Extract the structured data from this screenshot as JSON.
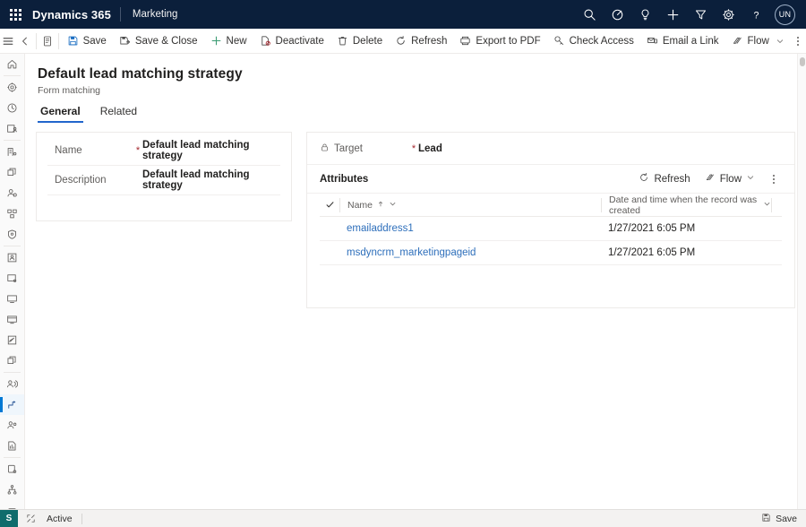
{
  "suitebar": {
    "waffle": "app-launcher",
    "brand": "Dynamics 365",
    "app_name": "Marketing",
    "avatar_initials": "UN",
    "icons": [
      {
        "name": "search-icon",
        "label": "Search"
      },
      {
        "name": "focus-target-icon",
        "label": "Focused view"
      },
      {
        "name": "lightbulb-icon",
        "label": "Insights"
      },
      {
        "name": "plus-icon",
        "label": "Quick create"
      },
      {
        "name": "filter-icon",
        "label": "Filter"
      },
      {
        "name": "gear-icon",
        "label": "Settings"
      },
      {
        "name": "help-icon",
        "label": "Help"
      }
    ],
    "colors": {
      "background": "#0b1f3b",
      "foreground": "#ffffff"
    }
  },
  "commandbar": {
    "hamburger": "site-map-toggle",
    "back": "back-arrow",
    "form_selector": "form-icon",
    "items": [
      {
        "name": "save-button",
        "label": "Save",
        "icon": "save-icon"
      },
      {
        "name": "save-and-close-button",
        "label": "Save & Close",
        "icon": "save-close-icon"
      },
      {
        "name": "new-button",
        "label": "New",
        "icon": "plus-icon"
      },
      {
        "name": "deactivate-button",
        "label": "Deactivate",
        "icon": "deactivate-icon"
      },
      {
        "name": "delete-button",
        "label": "Delete",
        "icon": "trash-icon"
      },
      {
        "name": "refresh-button",
        "label": "Refresh",
        "icon": "refresh-icon"
      },
      {
        "name": "export-to-pdf-button",
        "label": "Export to PDF",
        "icon": "pdf-icon"
      },
      {
        "name": "check-access-button",
        "label": "Check Access",
        "icon": "key-icon"
      },
      {
        "name": "email-a-link-button",
        "label": "Email a Link",
        "icon": "email-link-icon"
      },
      {
        "name": "flow-button",
        "label": "Flow",
        "icon": "flow-icon",
        "has_chevron": true
      }
    ],
    "overflow": "more-commands"
  },
  "sidebar": {
    "selected_index": 16,
    "items": [
      {
        "name": "sidebar-item-home",
        "icon": "home-icon"
      },
      {
        "name": "sidebar-item-settings",
        "icon": "gear-icon"
      },
      {
        "name": "sidebar-item-recent",
        "icon": "clock-icon"
      },
      {
        "name": "sidebar-item-contacts",
        "icon": "contact-card-icon"
      },
      {
        "name": "sidebar-item-accounts",
        "icon": "building-icon"
      },
      {
        "name": "sidebar-item-segments",
        "icon": "layers-icon"
      },
      {
        "name": "sidebar-item-leads",
        "icon": "person-search-icon"
      },
      {
        "name": "sidebar-item-journeys",
        "icon": "grid-nodes-icon"
      },
      {
        "name": "sidebar-item-security",
        "icon": "shield-icon"
      },
      {
        "name": "sidebar-item-forms",
        "icon": "form-card-icon"
      },
      {
        "name": "sidebar-item-pages",
        "icon": "page-icon"
      },
      {
        "name": "sidebar-item-templates",
        "icon": "monitor-icon"
      },
      {
        "name": "sidebar-item-websites",
        "icon": "browser-icon"
      },
      {
        "name": "sidebar-item-surveys",
        "icon": "edit-page-icon"
      },
      {
        "name": "sidebar-item-stacks",
        "icon": "copy-icon"
      },
      {
        "name": "sidebar-item-customer-voice",
        "icon": "people-gear-icon"
      },
      {
        "name": "sidebar-item-matching-strategy",
        "icon": "branch-arrow-icon"
      },
      {
        "name": "sidebar-item-audience",
        "icon": "people-icon"
      },
      {
        "name": "sidebar-item-reports",
        "icon": "document-chart-icon"
      },
      {
        "name": "sidebar-item-database",
        "icon": "database-gear-icon"
      },
      {
        "name": "sidebar-item-hierarchy",
        "icon": "org-chart-icon"
      },
      {
        "name": "sidebar-item-toggle",
        "icon": "toggle-icon"
      }
    ]
  },
  "page": {
    "title": "Default lead matching strategy",
    "subtitle": "Form matching",
    "tabs": [
      {
        "name": "tab-general",
        "label": "General",
        "active": true
      },
      {
        "name": "tab-related",
        "label": "Related",
        "active": false
      }
    ]
  },
  "general_form": {
    "fields": [
      {
        "name": "name-field",
        "label": "Name",
        "required": true,
        "value": "Default lead matching strategy"
      },
      {
        "name": "description-field",
        "label": "Description",
        "required": false,
        "value": "Default lead matching strategy"
      }
    ]
  },
  "target_section": {
    "lock_icon": "lock-icon",
    "label": "Target",
    "required": true,
    "value": "Lead"
  },
  "attributes_subgrid": {
    "title": "Attributes",
    "actions": [
      {
        "name": "subgrid-refresh-button",
        "label": "Refresh",
        "icon": "refresh-icon"
      },
      {
        "name": "subgrid-flow-button",
        "label": "Flow",
        "icon": "flow-icon",
        "has_chevron": true
      }
    ],
    "overflow": "subgrid-more-commands",
    "columns": [
      {
        "name": "column-header-name",
        "label": "Name",
        "sort": "ascending"
      },
      {
        "name": "column-header-created-on",
        "label": "Date and time when the record was created"
      }
    ],
    "rows": [
      {
        "name": "emailaddress1",
        "created_on": "1/27/2021 6:05 PM"
      },
      {
        "name": "msdyncrm_marketingpageid",
        "created_on": "1/27/2021 6:05 PM"
      }
    ]
  },
  "statusbar": {
    "badge": "S",
    "expand_icon": "expand-icon",
    "status": "Active",
    "save_label": "Save",
    "save_icon": "save-icon"
  },
  "colors": {
    "accent": "#0078d4",
    "tab_underline": "#2266cc",
    "link": "#2e6fbb",
    "required": "#a4262c",
    "suite_bg": "#0b1f3b",
    "status_badge": "#0f6c6c"
  }
}
